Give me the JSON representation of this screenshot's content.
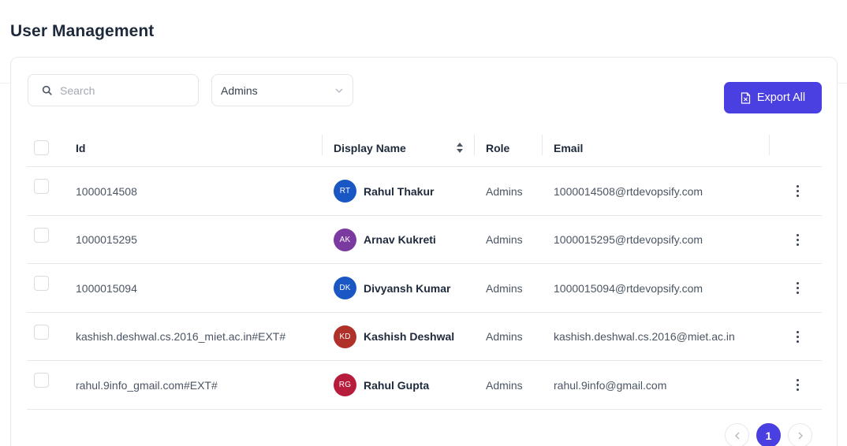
{
  "page": {
    "title": "User Management"
  },
  "toolbar": {
    "search_placeholder": "Search",
    "filter_value": "Admins",
    "export_label": "Export All"
  },
  "table": {
    "columns": [
      "Id",
      "Display Name",
      "Role",
      "Email"
    ],
    "rows": [
      {
        "id": "1000014508",
        "initials": "RT",
        "name": "Rahul Thakur",
        "role": "Admins",
        "email": "1000014508@rtdevopsify.com",
        "color": "#1a56c4"
      },
      {
        "id": "1000015295",
        "initials": "AK",
        "name": "Arnav Kukreti",
        "role": "Admins",
        "email": "1000015295@rtdevopsify.com",
        "color": "#7b3aa0"
      },
      {
        "id": "1000015094",
        "initials": "DK",
        "name": "Divyansh Kumar",
        "role": "Admins",
        "email": "1000015094@rtdevopsify.com",
        "color": "#1a56c4"
      },
      {
        "id": "kashish.deshwal.cs.2016_miet.ac.in#EXT#",
        "initials": "KD",
        "name": "Kashish Deshwal",
        "role": "Admins",
        "email": "kashish.deshwal.cs.2016@miet.ac.in",
        "color": "#b0302a"
      },
      {
        "id": "rahul.9info_gmail.com#EXT#",
        "initials": "RG",
        "name": "Rahul Gupta",
        "role": "Admins",
        "email": "rahul.9info@gmail.com",
        "color": "#b81c3c"
      }
    ]
  },
  "pagination": {
    "current_page": "1"
  },
  "colors": {
    "accent": "#4a3fe0",
    "text": "#1e2a3b",
    "border": "#e6e8ec"
  }
}
